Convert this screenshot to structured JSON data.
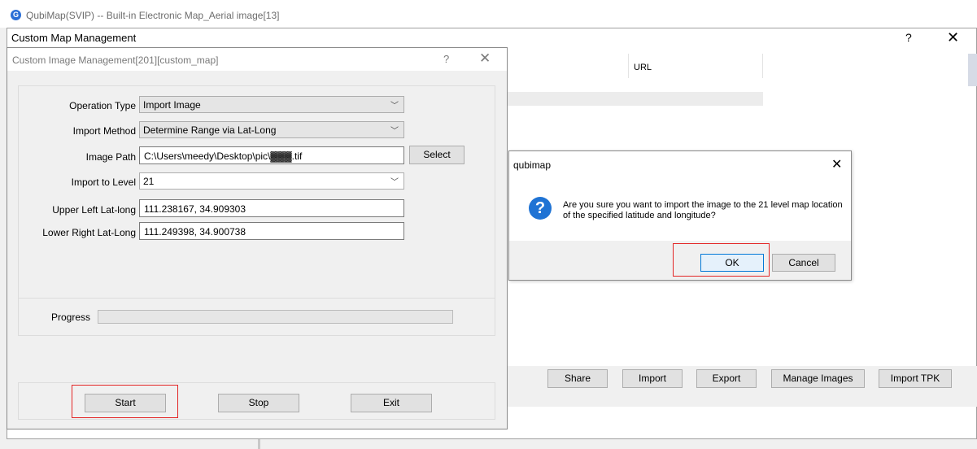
{
  "app": {
    "logo_glyph": "G",
    "title": "QubiMap(SVIP) -- Built-in Electronic Map_Aerial image[13]"
  },
  "custom_map_management": {
    "title": "Custom Map Management",
    "help": "?",
    "close": "✕",
    "table": {
      "url_header": "URL"
    },
    "buttons": {
      "share": "Share",
      "import": "Import",
      "export": "Export",
      "manage_images": "Manage Images",
      "import_tpk": "Import TPK"
    }
  },
  "custom_image_management": {
    "title": "Custom Image Management[201][custom_map]",
    "help": "?",
    "close": "✕",
    "form": {
      "operation_type_label": "Operation Type",
      "operation_type_value": "Import Image",
      "import_method_label": "Import Method",
      "import_method_value": "Determine Range via Lat-Long",
      "image_path_label": "Image Path",
      "image_path_value": "C:\\Users\\meedy\\Desktop\\pic\\▓▓▓.tif",
      "select_button": "Select",
      "import_level_label": "Import to Level",
      "import_level_value": "21",
      "upper_left_label": "Upper Left Lat-long",
      "upper_left_value": "111.238167, 34.909303",
      "lower_right_label": "Lower Right Lat-Long",
      "lower_right_value": "111.249398, 34.900738"
    },
    "progress_label": "Progress",
    "progress_value": 0,
    "buttons": {
      "start": "Start",
      "stop": "Stop",
      "exit": "Exit"
    }
  },
  "message_box": {
    "title": "qubimap",
    "close": "✕",
    "icon_glyph": "?",
    "message": "Are you sure you want to import the image to the 21 level map location of the specified latitude and longitude?",
    "ok": "OK",
    "cancel": "Cancel"
  },
  "colors": {
    "highlight": "#e32626",
    "accent": "#0078d7",
    "question_icon": "#1f73d4"
  }
}
